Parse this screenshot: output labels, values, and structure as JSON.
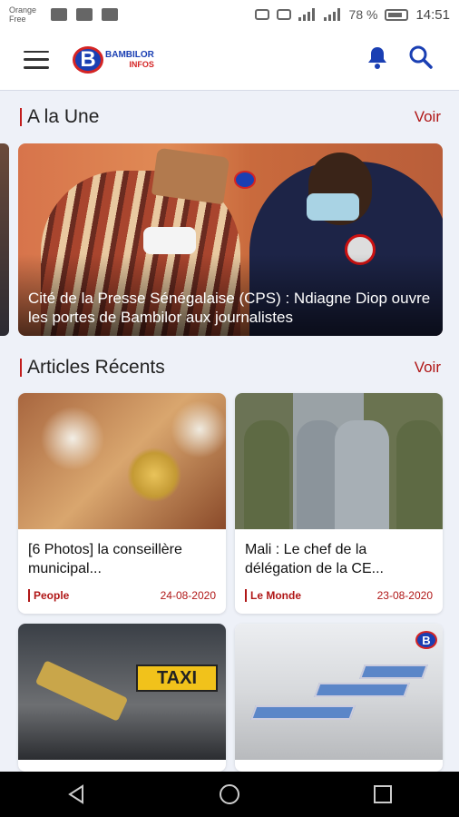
{
  "status_bar": {
    "carrier_line1": "Orange",
    "carrier_line2": "Free",
    "battery": "78 %",
    "time": "14:51"
  },
  "header": {
    "logo_line1": "BAMBILOR",
    "logo_line2": "INFOS",
    "logo_letter": "B"
  },
  "sections": {
    "une": {
      "title": "A la Une",
      "see_all": "Voir"
    },
    "recent": {
      "title": "Articles Récents",
      "see_all": "Voir"
    }
  },
  "featured": {
    "caption": "Cité de la Presse Sénégalaise (CPS) : Ndiagne Diop ouvre les portes de Bambilor aux journalistes"
  },
  "articles": [
    {
      "title": "[6 Photos] la conseillère municipal...",
      "category": "People",
      "date": "24-08-2020"
    },
    {
      "title": "Mali : Le chef de la délégation de la CE...",
      "category": "Le Monde",
      "date": "23-08-2020"
    },
    {
      "taxi_sign": "TAXI"
    },
    {
      "watermark": "B"
    }
  ],
  "colors": {
    "accent": "#b01717",
    "brand_blue": "#1a3fb3",
    "brand_red": "#d42424"
  }
}
